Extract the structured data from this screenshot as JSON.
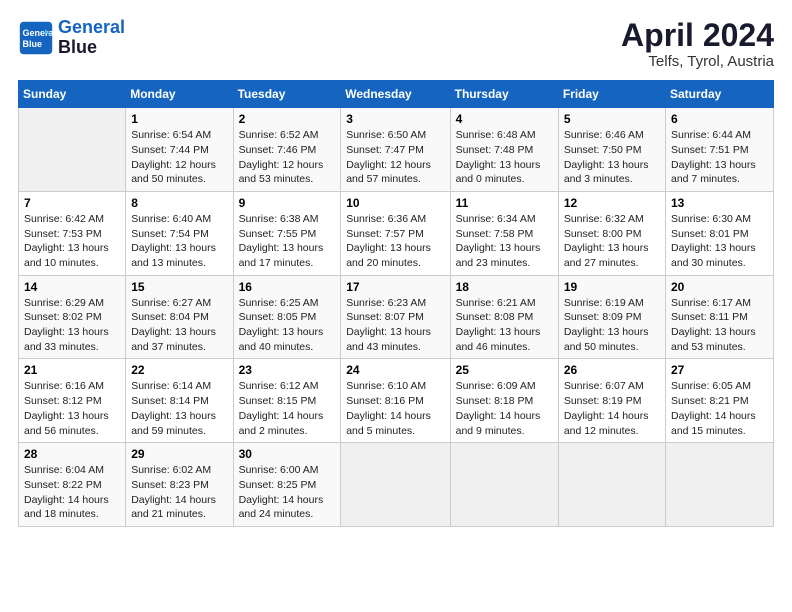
{
  "header": {
    "logo_line1": "General",
    "logo_line2": "Blue",
    "month": "April 2024",
    "location": "Telfs, Tyrol, Austria"
  },
  "weekdays": [
    "Sunday",
    "Monday",
    "Tuesday",
    "Wednesday",
    "Thursday",
    "Friday",
    "Saturday"
  ],
  "weeks": [
    [
      {
        "day": "",
        "info": ""
      },
      {
        "day": "1",
        "info": "Sunrise: 6:54 AM\nSunset: 7:44 PM\nDaylight: 12 hours\nand 50 minutes."
      },
      {
        "day": "2",
        "info": "Sunrise: 6:52 AM\nSunset: 7:46 PM\nDaylight: 12 hours\nand 53 minutes."
      },
      {
        "day": "3",
        "info": "Sunrise: 6:50 AM\nSunset: 7:47 PM\nDaylight: 12 hours\nand 57 minutes."
      },
      {
        "day": "4",
        "info": "Sunrise: 6:48 AM\nSunset: 7:48 PM\nDaylight: 13 hours\nand 0 minutes."
      },
      {
        "day": "5",
        "info": "Sunrise: 6:46 AM\nSunset: 7:50 PM\nDaylight: 13 hours\nand 3 minutes."
      },
      {
        "day": "6",
        "info": "Sunrise: 6:44 AM\nSunset: 7:51 PM\nDaylight: 13 hours\nand 7 minutes."
      }
    ],
    [
      {
        "day": "7",
        "info": "Sunrise: 6:42 AM\nSunset: 7:53 PM\nDaylight: 13 hours\nand 10 minutes."
      },
      {
        "day": "8",
        "info": "Sunrise: 6:40 AM\nSunset: 7:54 PM\nDaylight: 13 hours\nand 13 minutes."
      },
      {
        "day": "9",
        "info": "Sunrise: 6:38 AM\nSunset: 7:55 PM\nDaylight: 13 hours\nand 17 minutes."
      },
      {
        "day": "10",
        "info": "Sunrise: 6:36 AM\nSunset: 7:57 PM\nDaylight: 13 hours\nand 20 minutes."
      },
      {
        "day": "11",
        "info": "Sunrise: 6:34 AM\nSunset: 7:58 PM\nDaylight: 13 hours\nand 23 minutes."
      },
      {
        "day": "12",
        "info": "Sunrise: 6:32 AM\nSunset: 8:00 PM\nDaylight: 13 hours\nand 27 minutes."
      },
      {
        "day": "13",
        "info": "Sunrise: 6:30 AM\nSunset: 8:01 PM\nDaylight: 13 hours\nand 30 minutes."
      }
    ],
    [
      {
        "day": "14",
        "info": "Sunrise: 6:29 AM\nSunset: 8:02 PM\nDaylight: 13 hours\nand 33 minutes."
      },
      {
        "day": "15",
        "info": "Sunrise: 6:27 AM\nSunset: 8:04 PM\nDaylight: 13 hours\nand 37 minutes."
      },
      {
        "day": "16",
        "info": "Sunrise: 6:25 AM\nSunset: 8:05 PM\nDaylight: 13 hours\nand 40 minutes."
      },
      {
        "day": "17",
        "info": "Sunrise: 6:23 AM\nSunset: 8:07 PM\nDaylight: 13 hours\nand 43 minutes."
      },
      {
        "day": "18",
        "info": "Sunrise: 6:21 AM\nSunset: 8:08 PM\nDaylight: 13 hours\nand 46 minutes."
      },
      {
        "day": "19",
        "info": "Sunrise: 6:19 AM\nSunset: 8:09 PM\nDaylight: 13 hours\nand 50 minutes."
      },
      {
        "day": "20",
        "info": "Sunrise: 6:17 AM\nSunset: 8:11 PM\nDaylight: 13 hours\nand 53 minutes."
      }
    ],
    [
      {
        "day": "21",
        "info": "Sunrise: 6:16 AM\nSunset: 8:12 PM\nDaylight: 13 hours\nand 56 minutes."
      },
      {
        "day": "22",
        "info": "Sunrise: 6:14 AM\nSunset: 8:14 PM\nDaylight: 13 hours\nand 59 minutes."
      },
      {
        "day": "23",
        "info": "Sunrise: 6:12 AM\nSunset: 8:15 PM\nDaylight: 14 hours\nand 2 minutes."
      },
      {
        "day": "24",
        "info": "Sunrise: 6:10 AM\nSunset: 8:16 PM\nDaylight: 14 hours\nand 5 minutes."
      },
      {
        "day": "25",
        "info": "Sunrise: 6:09 AM\nSunset: 8:18 PM\nDaylight: 14 hours\nand 9 minutes."
      },
      {
        "day": "26",
        "info": "Sunrise: 6:07 AM\nSunset: 8:19 PM\nDaylight: 14 hours\nand 12 minutes."
      },
      {
        "day": "27",
        "info": "Sunrise: 6:05 AM\nSunset: 8:21 PM\nDaylight: 14 hours\nand 15 minutes."
      }
    ],
    [
      {
        "day": "28",
        "info": "Sunrise: 6:04 AM\nSunset: 8:22 PM\nDaylight: 14 hours\nand 18 minutes."
      },
      {
        "day": "29",
        "info": "Sunrise: 6:02 AM\nSunset: 8:23 PM\nDaylight: 14 hours\nand 21 minutes."
      },
      {
        "day": "30",
        "info": "Sunrise: 6:00 AM\nSunset: 8:25 PM\nDaylight: 14 hours\nand 24 minutes."
      },
      {
        "day": "",
        "info": ""
      },
      {
        "day": "",
        "info": ""
      },
      {
        "day": "",
        "info": ""
      },
      {
        "day": "",
        "info": ""
      }
    ]
  ]
}
